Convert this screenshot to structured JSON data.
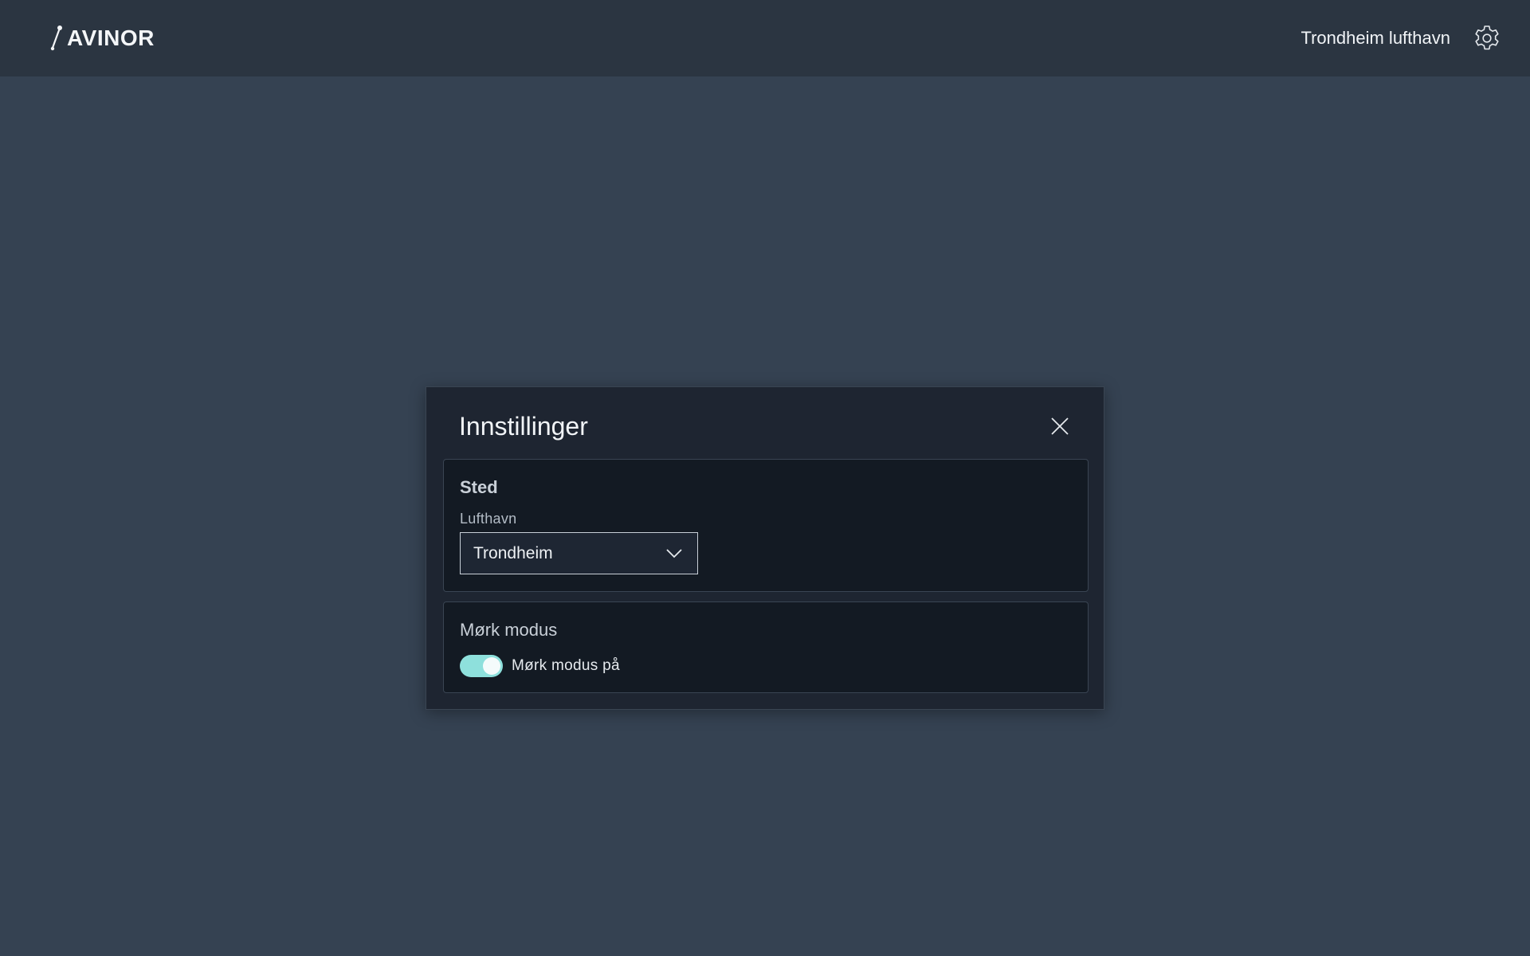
{
  "header": {
    "logo_text": "AVINOR",
    "airport_name": "Trondheim lufthavn",
    "settings_icon": "gear-icon"
  },
  "modal": {
    "title": "Innstillinger",
    "close_icon": "close-icon",
    "location_section": {
      "title": "Sted",
      "airport_label": "Lufthavn",
      "airport_selected": "Trondheim",
      "dropdown_icon": "chevron-down-icon"
    },
    "dark_mode_section": {
      "title": "Mørk modus",
      "toggle_label": "Mørk modus på",
      "toggle_on": true
    }
  },
  "colors": {
    "background": "#354252",
    "topbar": "#2b3541",
    "modal": "#1e2531",
    "section": "#131a23",
    "toggle_accent": "#8ee0dc"
  }
}
